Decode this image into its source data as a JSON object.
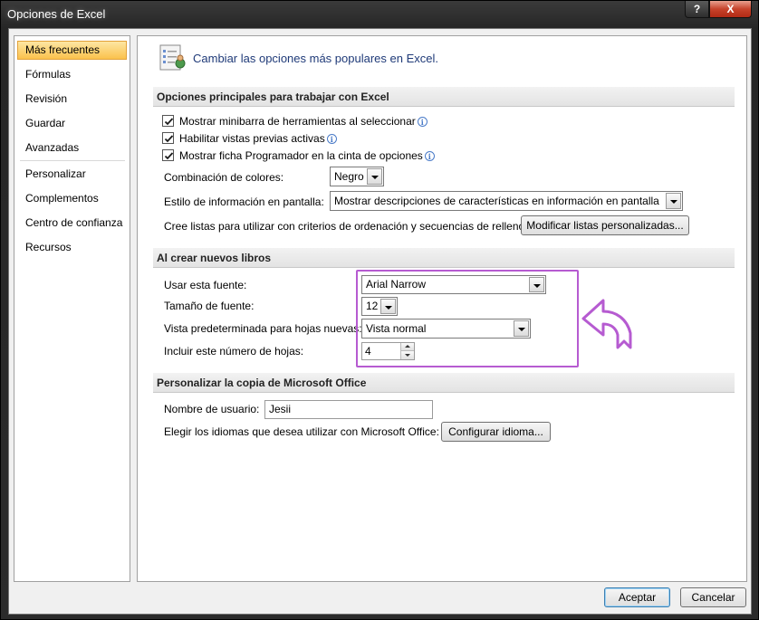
{
  "window": {
    "title": "Opciones de Excel",
    "help_label": "?",
    "close_label": "X"
  },
  "sidebar": {
    "items": [
      {
        "label": "Más frecuentes",
        "active": true
      },
      {
        "label": "Fórmulas"
      },
      {
        "label": "Revisión"
      },
      {
        "label": "Guardar"
      },
      {
        "label": "Avanzadas"
      },
      {
        "label": "Personalizar"
      },
      {
        "label": "Complementos"
      },
      {
        "label": "Centro de confianza"
      },
      {
        "label": "Recursos"
      }
    ]
  },
  "header": {
    "title": "Cambiar las opciones más populares en Excel."
  },
  "sections": {
    "principal": {
      "title": "Opciones principales para trabajar con Excel",
      "minibar": "Mostrar minibarra de herramientas al seleccionar",
      "preview": "Habilitar vistas previas activas",
      "developer": "Mostrar ficha Programador en la cinta de opciones",
      "color_label": "Combinación de colores:",
      "color_value": "Negro",
      "tooltip_label": "Estilo de información en pantalla:",
      "tooltip_value": "Mostrar descripciones de características en información en pantalla",
      "lists_label": "Cree listas para utilizar con criterios de ordenación y secuencias de relleno:",
      "lists_button": "Modificar listas personalizadas..."
    },
    "new_books": {
      "title": "Al crear nuevos libros",
      "font_label": "Usar esta fuente:",
      "font_value": "Arial Narrow",
      "size_label": "Tamaño de fuente:",
      "size_value": "12",
      "view_label": "Vista predeterminada para hojas nuevas:",
      "view_value": "Vista normal",
      "sheets_label": "Incluir este número de hojas:",
      "sheets_value": "4"
    },
    "personalize": {
      "title": "Personalizar la copia de Microsoft Office",
      "username_label": "Nombre de usuario:",
      "username_value": "Jesii",
      "languages_label": "Elegir los idiomas que desea utilizar con Microsoft Office:",
      "languages_button": "Configurar idioma..."
    }
  },
  "footer": {
    "accept": "Aceptar",
    "cancel": "Cancelar"
  },
  "colors": {
    "accent_highlight": "#b65bd1",
    "active_item": "#fbc24d",
    "header_text": "#1f3a78"
  }
}
